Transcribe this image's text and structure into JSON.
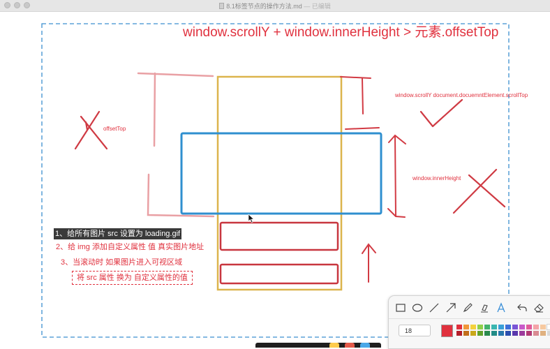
{
  "window": {
    "title": "8.1标签节点的操作方法.md",
    "status": "— 已编辑"
  },
  "canvas": {
    "heading": "window.scrollY + window.innerHeight > 元素.offsetTop",
    "label_offset_top": "offsetTop",
    "label_scroll_top": "window.scrollY  document.docuemntElement.scrollTop",
    "label_inner_height": "window.innerHeight",
    "steps": [
      "1、给所有图片 src 设置为 loading.gif",
      "2、给 img 添加自定义属性 值 真实图片地址",
      "3、当滚动时 如果图片进入可视区域",
      "将  src 属性 换为 自定义属性的值"
    ]
  },
  "toolbar": {
    "tools": [
      "rectangle-tool",
      "ellipse-tool",
      "line-tool",
      "arrow-tool",
      "pen-tool",
      "highlighter-tool",
      "text-tool",
      "undo-tool",
      "eraser-tool",
      "close-tool"
    ],
    "size_value": "18",
    "current_color": "#e0313e",
    "swatches": [
      "#e0313e",
      "#f0973a",
      "#f4d23c",
      "#8fd04a",
      "#43b36b",
      "#3ab6b0",
      "#3a9fd8",
      "#3e6fd9",
      "#7a55d6",
      "#c858c8",
      "#e05b9a",
      "#f4a3a8",
      "#f7c9a0",
      "#ffffff",
      "#b3202c",
      "#c26f1c",
      "#c9a81a",
      "#62a22c",
      "#2a8a4e",
      "#228c87",
      "#2a78ad",
      "#2c4fae",
      "#5a38ad",
      "#9c3b9c",
      "#b23b75",
      "#d98b92",
      "#e0b180",
      "#d9d9d9"
    ]
  }
}
